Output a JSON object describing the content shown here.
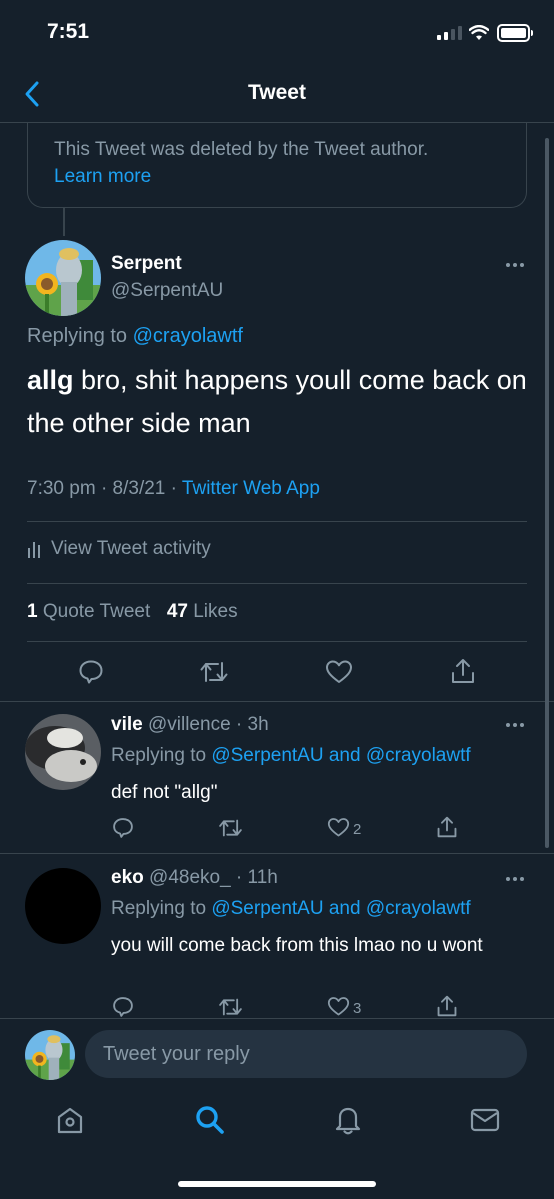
{
  "status_bar": {
    "time": "7:51"
  },
  "header": {
    "title": "Tweet"
  },
  "deleted_notice": {
    "text": "This Tweet was deleted by the Tweet author.",
    "link": "Learn more"
  },
  "main_tweet": {
    "display_name": "Serpent",
    "handle": "@SerpentAU",
    "replying_prefix": "Replying to",
    "replying_to": "@crayolawtf",
    "text_bold": "allg",
    "text_rest": " bro, shit happens youll come back on the other side man",
    "time": "7:30 pm",
    "date": "8/3/21",
    "source": "Twitter Web App",
    "activity_label": "View Tweet activity",
    "quote_count": "1",
    "quote_label": "Quote Tweet",
    "like_count": "47",
    "like_label": "Likes"
  },
  "replies": [
    {
      "display_name": "vile",
      "handle": "@villence",
      "age": "3h",
      "replying_prefix": "Replying to",
      "mentions": "@SerpentAU and @crayolawtf",
      "text": "def not \"allg\"",
      "like_count": "2"
    },
    {
      "display_name": "eko",
      "handle": "@48eko_",
      "age": "11h",
      "replying_prefix": "Replying to",
      "mentions": "@SerpentAU and @crayolawtf",
      "text": "you will come back from this lmao no u wont",
      "like_count": "3"
    }
  ],
  "composer": {
    "placeholder": "Tweet your reply"
  },
  "colors": {
    "background": "#15202b",
    "accent": "#1da1f2",
    "muted": "#8899a6",
    "divider": "#38444d"
  },
  "icons": [
    "back-icon",
    "more-icon",
    "activity-icon",
    "reply-icon",
    "retweet-icon",
    "like-icon",
    "share-icon",
    "home-icon",
    "search-icon",
    "notifications-icon",
    "messages-icon"
  ]
}
